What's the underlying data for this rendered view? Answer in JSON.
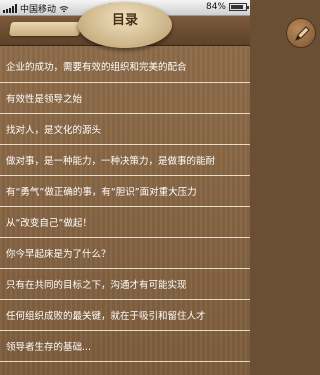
{
  "status_bar": {
    "carrier": "中国移动",
    "network_icon": "wifi-icon",
    "time": "15:23",
    "battery_percent": "84%",
    "battery_level": 0.84
  },
  "header": {
    "title": "目录",
    "right_icon": "pen-icon"
  },
  "list": {
    "items": [
      {
        "label": "企业的成功，需要有效的组织和完美的配合"
      },
      {
        "label": "有效性是领导之始"
      },
      {
        "label": "找对人，是文化的源头"
      },
      {
        "label": "做对事，是一种能力，一种决策力，是做事的能耐"
      },
      {
        "label": "有“勇气”做正确的事，有“胆识”面对重大压力"
      },
      {
        "label": "从“改变自己”做起！"
      },
      {
        "label": "你今早起床是为了什么？"
      },
      {
        "label": "只有在共同的目标之下，沟通才有可能实现"
      },
      {
        "label": "任何组织成败的最关键，就在于吸引和留住人才"
      },
      {
        "label": "领导者生存的基础..."
      }
    ]
  }
}
